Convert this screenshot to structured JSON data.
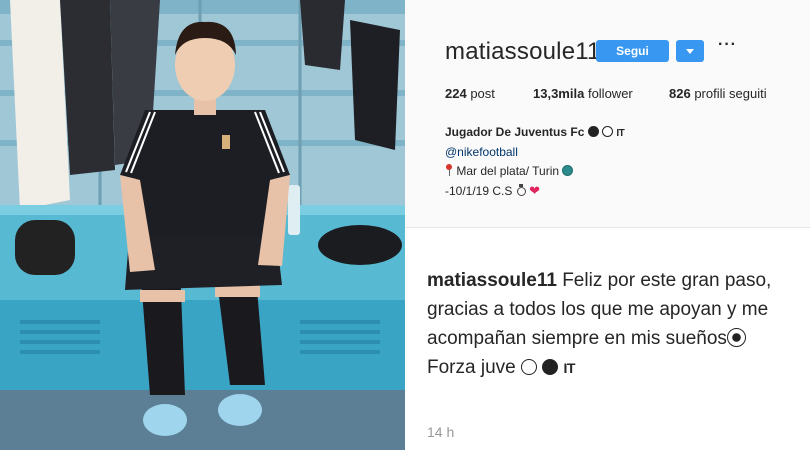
{
  "profile": {
    "username": "matiassoule11",
    "follow_label": "Segui",
    "more_label": "···",
    "stats": {
      "posts_count": "224",
      "posts_label": "post",
      "followers_count": "13,3mila",
      "followers_label": "follower",
      "following_count": "826",
      "following_label": "profili seguiti"
    },
    "bio": {
      "name": "Jugador De Juventus Fc",
      "name_suffix": "IT",
      "link": "@nikefootball",
      "location": "Mar del plata/ Turin",
      "date_line": "-10/1/19 C.S"
    }
  },
  "caption": {
    "username": "matiassoule11",
    "line1": "Feliz por este gran paso, gracias a todos los que me apoyan y me acompañan siempre en mis sueños",
    "line2_prefix": "Forza juve",
    "line2_suffix": "IT",
    "timestamp": "14 h"
  },
  "colors": {
    "accent": "#3897f0",
    "profile_bg": "#fafafa",
    "link": "#003569",
    "timestamp": "#999999"
  },
  "icons": {
    "dropdown": "chevron-down-icon",
    "more": "more-options-icon",
    "pin": "round-pushpin-icon",
    "globe": "globe-icon",
    "medal": "medal-icon",
    "heart": "heart-icon",
    "ball": "soccer-ball-icon"
  }
}
